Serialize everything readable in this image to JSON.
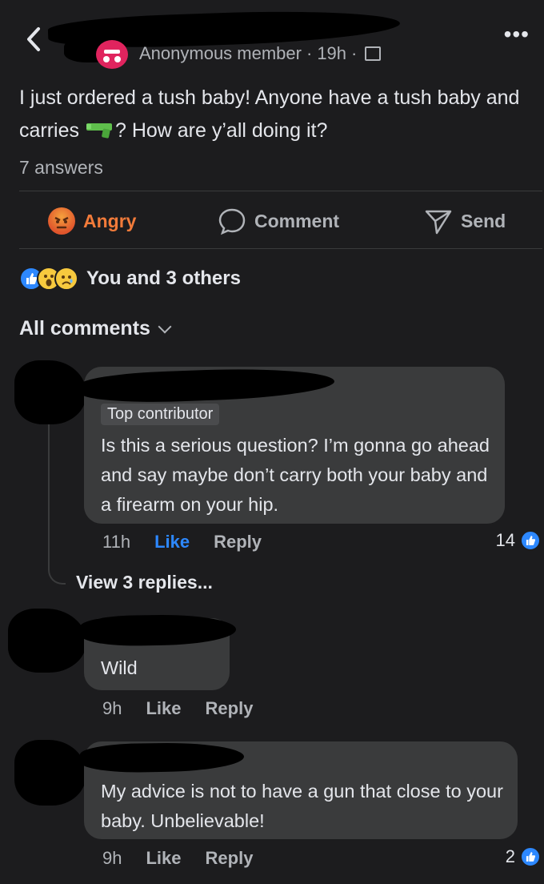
{
  "header": {
    "author": "Anonymous member",
    "age": "19h",
    "more_label": "•••"
  },
  "post": {
    "text_before": "I just ordered a tush baby! Anyone have a tush baby and carries",
    "text_after": "? How are y’all doing it?",
    "answers": "7 answers"
  },
  "actions": {
    "angry": "Angry",
    "comment": "Comment",
    "send": "Send"
  },
  "reactions": {
    "summary": "You and 3 others"
  },
  "comments_header": "All comments",
  "comments": [
    {
      "badge": "Top contributor",
      "text": "Is this a serious question? I’m gonna go ahead and say maybe don’t carry both your baby and a firearm on your hip.",
      "time": "11h",
      "like": "Like",
      "reply": "Reply",
      "count": "14",
      "view_replies": "View 3 replies..."
    },
    {
      "text": "Wild",
      "time": "9h",
      "like": "Like",
      "reply": "Reply"
    },
    {
      "text": "My advice is not to have a gun that close to your baby. Unbelievable!",
      "time": "9h",
      "like": "Like",
      "reply": "Reply",
      "count": "2"
    }
  ],
  "colors": {
    "background": "#1c1c1e",
    "bubble": "#3a3b3c",
    "like_blue": "#2d88ff",
    "angry_orange": "#f27b3a"
  }
}
